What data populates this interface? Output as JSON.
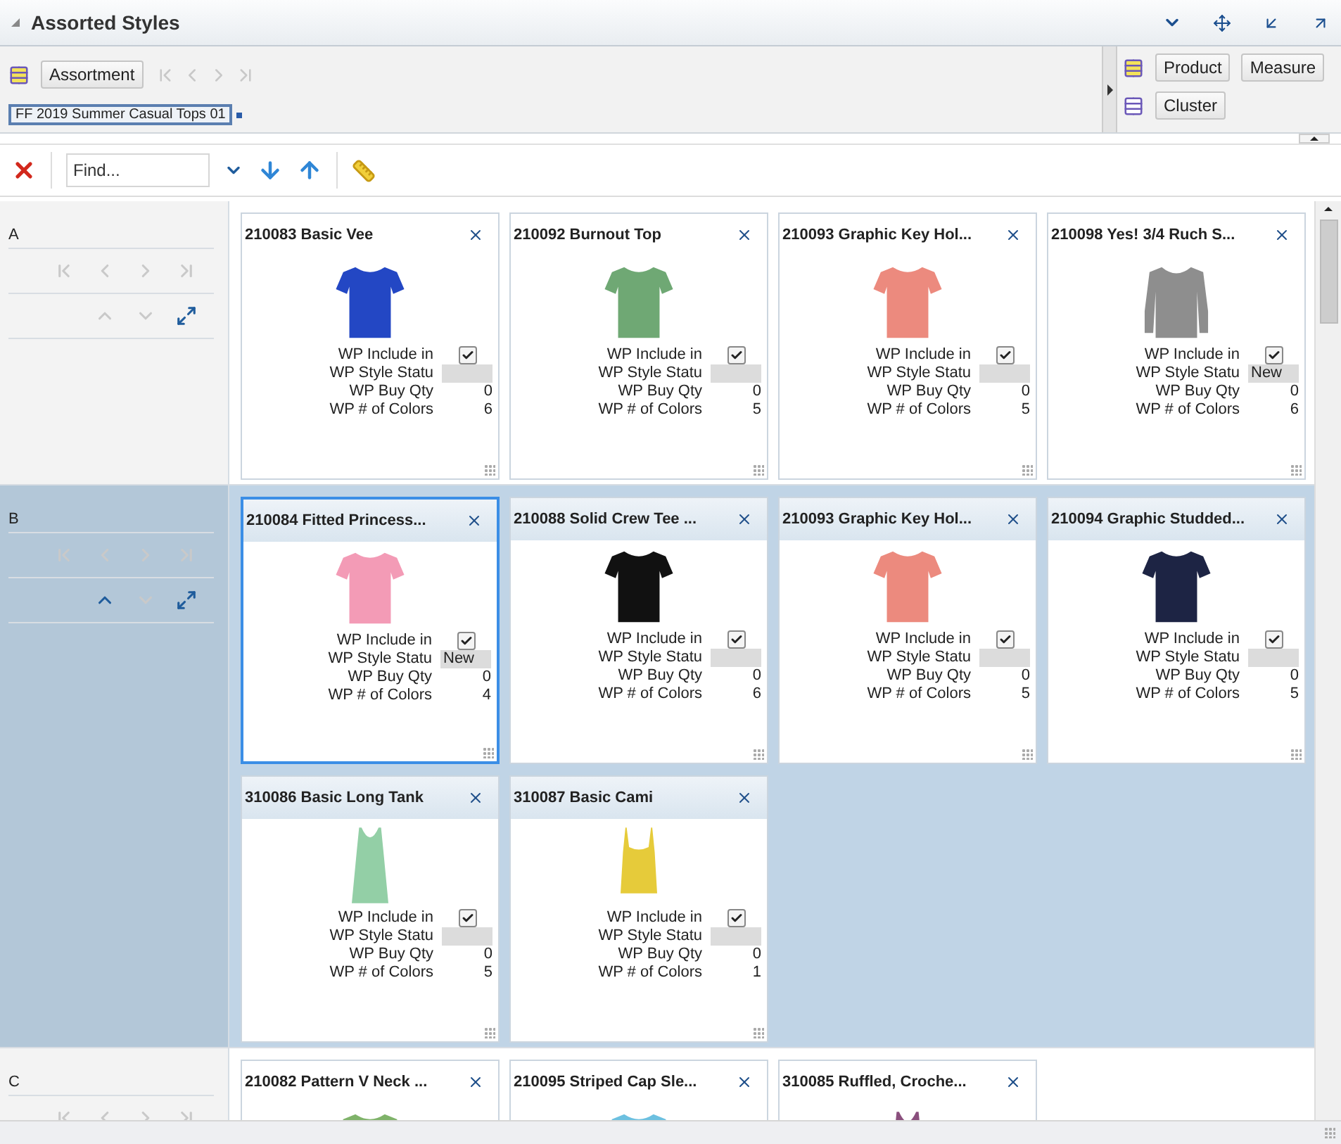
{
  "panel": {
    "title": "Assorted Styles"
  },
  "dimension_bar": {
    "buttons": [
      "Assortment"
    ],
    "nav": [
      {
        "kind": "first",
        "disabled": true
      },
      {
        "kind": "prev",
        "disabled": true
      },
      {
        "kind": "next",
        "disabled": true
      },
      {
        "kind": "last",
        "disabled": true
      }
    ],
    "tag": "FF 2019 Summer Casual Tops 01",
    "right_rows": [
      [
        "Product",
        "Measure"
      ],
      [
        "Cluster"
      ]
    ]
  },
  "find_bar": {
    "placeholder": "Find..."
  },
  "groups": [
    {
      "label": "A",
      "selected": false,
      "nav": [
        {
          "kind": "first",
          "disabled": true
        },
        {
          "kind": "prev",
          "disabled": true
        },
        {
          "kind": "next",
          "disabled": true
        },
        {
          "kind": "last",
          "disabled": true
        }
      ],
      "move": [
        {
          "kind": "up",
          "disabled": true
        },
        {
          "kind": "down",
          "disabled": true
        },
        {
          "kind": "expand",
          "disabled": false
        }
      ],
      "cards": [
        {
          "title": "210083 Basic Vee",
          "selected": false,
          "color": "#2347c4",
          "kind": "tee",
          "fields": [
            {
              "kind": "check",
              "label": "WP Include in",
              "checked": true
            },
            {
              "kind": "status",
              "label": "WP Style Statu"
            },
            {
              "kind": "number",
              "label": "WP Buy Qty",
              "value": "0"
            },
            {
              "kind": "number",
              "label": "WP # of Colors",
              "value": "6"
            }
          ]
        },
        {
          "title": "210092 Burnout Top",
          "selected": false,
          "color": "#6fa874",
          "kind": "tee",
          "fields": [
            {
              "kind": "check",
              "label": "WP Include in",
              "checked": true
            },
            {
              "kind": "status",
              "label": "WP Style Statu"
            },
            {
              "kind": "number",
              "label": "WP Buy Qty",
              "value": "0"
            },
            {
              "kind": "number",
              "label": "WP # of Colors",
              "value": "5"
            }
          ]
        },
        {
          "title": "210093 Graphic Key Hol...",
          "selected": false,
          "color": "#ec8a7e",
          "kind": "tee",
          "fields": [
            {
              "kind": "check",
              "label": "WP Include in",
              "checked": true
            },
            {
              "kind": "status",
              "label": "WP Style Statu"
            },
            {
              "kind": "number",
              "label": "WP Buy Qty",
              "value": "0"
            },
            {
              "kind": "number",
              "label": "WP # of Colors",
              "value": "5"
            }
          ]
        },
        {
          "title": "210098 Yes! 3/4 Ruch S...",
          "selected": false,
          "color": "#8e8e8e",
          "kind": "longsleeve",
          "fields": [
            {
              "kind": "check",
              "label": "WP Include in",
              "checked": true
            },
            {
              "kind": "status",
              "label": "WP Style Statu",
              "value": "New"
            },
            {
              "kind": "number",
              "label": "WP Buy Qty",
              "value": "0"
            },
            {
              "kind": "number",
              "label": "WP # of Colors",
              "value": "6"
            }
          ]
        }
      ]
    },
    {
      "label": "B",
      "selected": true,
      "nav": [
        {
          "kind": "first",
          "disabled": true
        },
        {
          "kind": "prev",
          "disabled": true
        },
        {
          "kind": "next",
          "disabled": true
        },
        {
          "kind": "last",
          "disabled": true
        }
      ],
      "move": [
        {
          "kind": "up",
          "disabled": false
        },
        {
          "kind": "down",
          "disabled": true
        },
        {
          "kind": "expand",
          "disabled": false
        }
      ],
      "cards": [
        {
          "title": "210084 Fitted Princess...",
          "selected": true,
          "color": "#f39bb6",
          "kind": "tee",
          "fields": [
            {
              "kind": "check",
              "label": "WP Include in",
              "checked": true
            },
            {
              "kind": "status",
              "label": "WP Style Statu",
              "value": "New"
            },
            {
              "kind": "number",
              "label": "WP Buy Qty",
              "value": "0"
            },
            {
              "kind": "number",
              "label": "WP # of Colors",
              "value": "4"
            }
          ]
        },
        {
          "title": "210088 Solid Crew Tee ...",
          "selected": false,
          "color": "#111111",
          "kind": "tee",
          "fields": [
            {
              "kind": "check",
              "label": "WP Include in",
              "checked": true
            },
            {
              "kind": "status",
              "label": "WP Style Statu"
            },
            {
              "kind": "number",
              "label": "WP Buy Qty",
              "value": "0"
            },
            {
              "kind": "number",
              "label": "WP # of Colors",
              "value": "6"
            }
          ]
        },
        {
          "title": "210093 Graphic Key Hol...",
          "selected": false,
          "color": "#ec8a7e",
          "kind": "tee",
          "fields": [
            {
              "kind": "check",
              "label": "WP Include in",
              "checked": true
            },
            {
              "kind": "status",
              "label": "WP Style Statu"
            },
            {
              "kind": "number",
              "label": "WP Buy Qty",
              "value": "0"
            },
            {
              "kind": "number",
              "label": "WP # of Colors",
              "value": "5"
            }
          ]
        },
        {
          "title": "210094 Graphic Studded...",
          "selected": false,
          "color": "#1d2444",
          "kind": "tee",
          "fields": [
            {
              "kind": "check",
              "label": "WP Include in",
              "checked": true
            },
            {
              "kind": "status",
              "label": "WP Style Statu"
            },
            {
              "kind": "number",
              "label": "WP Buy Qty",
              "value": "0"
            },
            {
              "kind": "number",
              "label": "WP # of Colors",
              "value": "5"
            }
          ]
        },
        {
          "title": "310086 Basic Long Tank",
          "selected": false,
          "color": "#93cfa6",
          "kind": "tank",
          "fields": [
            {
              "kind": "check",
              "label": "WP Include in",
              "checked": true
            },
            {
              "kind": "status",
              "label": "WP Style Statu"
            },
            {
              "kind": "number",
              "label": "WP Buy Qty",
              "value": "0"
            },
            {
              "kind": "number",
              "label": "WP # of Colors",
              "value": "5"
            }
          ]
        },
        {
          "title": "310087 Basic Cami",
          "selected": false,
          "color": "#e6cb3a",
          "kind": "cami",
          "fields": [
            {
              "kind": "check",
              "label": "WP Include in",
              "checked": true
            },
            {
              "kind": "status",
              "label": "WP Style Statu"
            },
            {
              "kind": "number",
              "label": "WP Buy Qty",
              "value": "0"
            },
            {
              "kind": "number",
              "label": "WP # of Colors",
              "value": "1"
            }
          ]
        }
      ]
    },
    {
      "label": "C",
      "selected": false,
      "nav": [
        {
          "kind": "first",
          "disabled": true
        },
        {
          "kind": "prev",
          "disabled": true
        },
        {
          "kind": "next",
          "disabled": true
        },
        {
          "kind": "last",
          "disabled": true
        }
      ],
      "cards": [
        {
          "title": "210082 Pattern V Neck ...",
          "selected": false,
          "color": "#7fb36a",
          "kind": "tee"
        },
        {
          "title": "210095 Striped Cap Sle...",
          "selected": false,
          "color": "#6cc0e0",
          "kind": "tee"
        },
        {
          "title": "310085 Ruffled, Croche...",
          "selected": false,
          "color": "#8a4f7d",
          "kind": "tank"
        }
      ]
    }
  ]
}
